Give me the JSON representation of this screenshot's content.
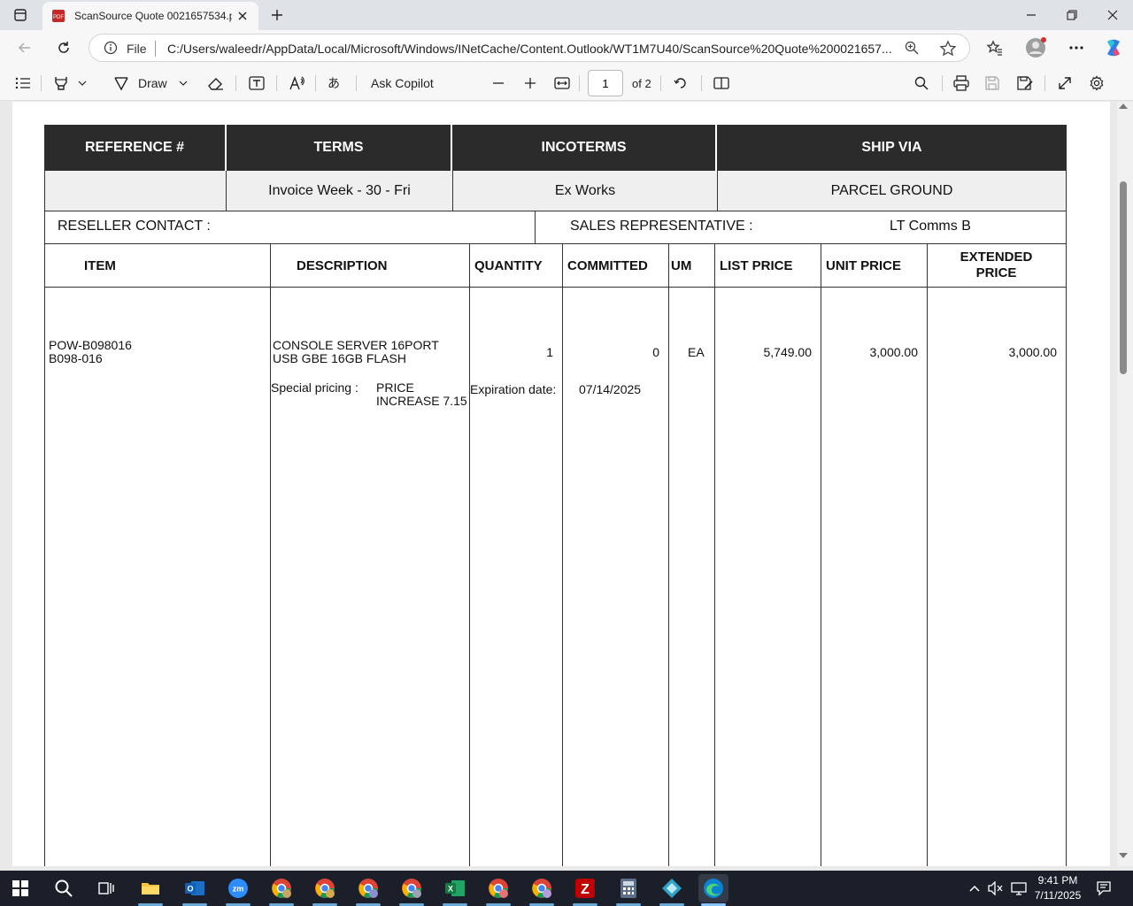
{
  "browser": {
    "tab_title": "ScanSource Quote 0021657534.p",
    "address": {
      "scheme_label": "File",
      "url": "C:/Users/waleedr/AppData/Local/Microsoft/Windows/INetCache/Content.Outlook/WT1M7U40/ScanSource%20Quote%200021657..."
    }
  },
  "pdf_toolbar": {
    "draw_label": "Draw",
    "ask_copilot_label": "Ask Copilot",
    "page_current": "1",
    "page_total_label": "of 2"
  },
  "quote": {
    "header": {
      "reference_label": "REFERENCE #",
      "terms_label": "TERMS",
      "incoterms_label": "INCOTERMS",
      "ship_via_label": "SHIP VIA"
    },
    "values": {
      "reference": "",
      "terms": "Invoice Week - 30 - Fri",
      "incoterms": "Ex Works",
      "ship_via": "PARCEL GROUND"
    },
    "contact": {
      "reseller_contact_label": "RESELLER CONTACT :",
      "sales_rep_label": "SALES REPRESENTATIVE :",
      "sales_rep_value": "LT Comms B"
    },
    "columns": {
      "item": "ITEM",
      "description": "DESCRIPTION",
      "quantity": "QUANTITY",
      "committed": "COMMITTED",
      "um": "UM",
      "list_price": "LIST PRICE",
      "unit_price": "UNIT PRICE",
      "extended_price_1": "EXTENDED",
      "extended_price_2": "PRICE"
    },
    "line_items": [
      {
        "item_1": "POW-B098016",
        "item_2": "B098-016",
        "description_1": "CONSOLE SERVER 16PORT",
        "description_2": "USB GBE 16GB FLASH",
        "quantity": "1",
        "committed": "0",
        "um": "EA",
        "list_price": "5,749.00",
        "unit_price": "3,000.00",
        "extended_price": "3,000.00",
        "special_pricing_label": "Special pricing :",
        "special_pricing_1": "PRICE",
        "special_pricing_2": "INCREASE 7.15",
        "expiration_label": "Expiration date:",
        "expiration_date": "07/14/2025"
      }
    ]
  },
  "taskbar": {
    "clock_time": "9:41 PM",
    "clock_date": "7/11/2025"
  },
  "colors": {
    "header_bg": "#2b2b2b",
    "value_row_bg": "#efefef",
    "taskbar_bg": "#1b1f2a",
    "edge_accent": "#0a84d0"
  }
}
